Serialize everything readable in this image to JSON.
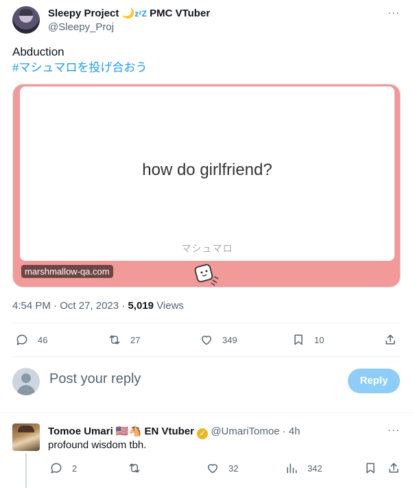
{
  "tweet": {
    "author_name": "Sleepy Project",
    "author_emoji": "🌙",
    "author_zz": "zᶻZ",
    "author_suffix": "PMC VTuber",
    "author_handle": "@Sleepy_Proj",
    "more": "···",
    "text": "Abduction",
    "hashtag": "#マシュマロを投げ合おう",
    "card": {
      "question": "how do girlfriend?",
      "brand": "マシュマロ",
      "domain": "marshmallow-qa.com"
    },
    "time": "4:54 PM",
    "date": "Oct 27, 2023",
    "views_count": "5,019",
    "views_label": "Views",
    "actions": {
      "replies": "46",
      "retweets": "27",
      "likes": "349",
      "bookmarks": "10"
    }
  },
  "reply_box": {
    "placeholder": "Post your reply",
    "button": "Reply"
  },
  "reply": {
    "author_name": "Tomoe Umari",
    "author_flags": "🇺🇸🐴",
    "author_suffix": "EN Vtuber",
    "verified": "✓",
    "author_handle": "@UmariTomoe",
    "separator": "·",
    "time": "4h",
    "more": "···",
    "text": "profound wisdom tbh.",
    "actions": {
      "replies": "2",
      "likes": "32",
      "views": "342"
    }
  },
  "colors": {
    "accent": "#1d9bf0",
    "reply_button": "#8ecdf8",
    "card_bg": "#f2999a"
  }
}
